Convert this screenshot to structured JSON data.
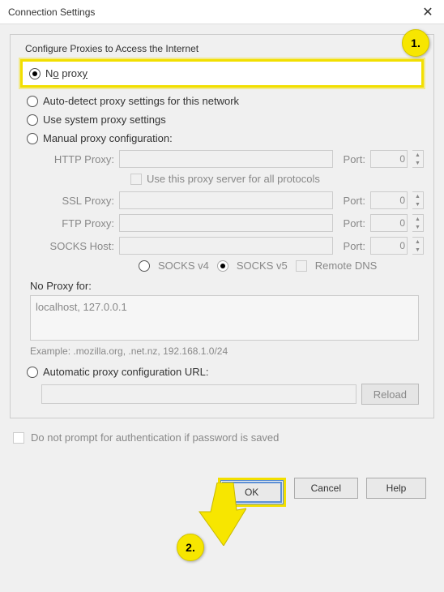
{
  "window": {
    "title": "Connection Settings"
  },
  "section_title": "Configure Proxies to Access the Internet",
  "radios": {
    "no_proxy": "No proxy",
    "auto_detect": "Auto-detect proxy settings for this network",
    "system": "Use system proxy settings",
    "manual": "Manual proxy configuration:",
    "auto_url": "Automatic proxy configuration URL:"
  },
  "fields": {
    "http_label": "HTTP Proxy:",
    "ssl_label": "SSL Proxy:",
    "ftp_label": "FTP Proxy:",
    "socks_label": "SOCKS Host:",
    "port_label": "Port:",
    "port_value": "0",
    "all_protocols": "Use this proxy server for all protocols"
  },
  "socks": {
    "v4": "SOCKS v4",
    "v5": "SOCKS v5",
    "remote_dns": "Remote DNS"
  },
  "noproxy": {
    "label": "No Proxy for:",
    "value": "localhost, 127.0.0.1",
    "example": "Example: .mozilla.org, .net.nz, 192.168.1.0/24"
  },
  "autourl": {
    "reload": "Reload"
  },
  "prompt_checkbox": "Do not prompt for authentication if password is saved",
  "buttons": {
    "ok": "OK",
    "cancel": "Cancel",
    "help": "Help"
  },
  "annotations": {
    "step1": "1.",
    "step2": "2."
  }
}
